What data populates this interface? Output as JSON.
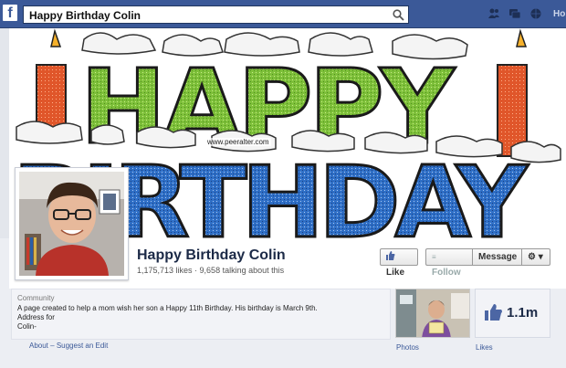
{
  "topbar": {
    "logo_letter": "f",
    "search_value": "Happy Birthday Colin",
    "home_label": "Ho"
  },
  "cover": {
    "watermark": "www.peeralter.com",
    "colors": {
      "happy": "#7ec03a",
      "birthday": "#2f6fc6",
      "candle": "#e0562a",
      "frosting": "#f2f2f2"
    }
  },
  "page": {
    "name": "Happy Birthday Colin",
    "likes": "1,175,713 likes",
    "separator": " · ",
    "talking": "9,658 talking about this"
  },
  "buttons": {
    "like": "Like",
    "follow": "Follow",
    "message": "Message",
    "gear_caret": "▾"
  },
  "about": {
    "category": "Community",
    "description_line1": "A page created to help a mom wish her son a Happy 11th Birthday. His birthday is March 9th.",
    "description_line2": "Address for",
    "description_line3": "Colin-",
    "about_link": "About",
    "links_separator": " – ",
    "suggest_link": "Suggest an Edit"
  },
  "apps": {
    "photos_label": "Photos",
    "likes_count": "1.1m",
    "likes_label": "Likes"
  },
  "colors": {
    "facebook_blue": "#3b5998",
    "link_blue": "#3b5998"
  }
}
